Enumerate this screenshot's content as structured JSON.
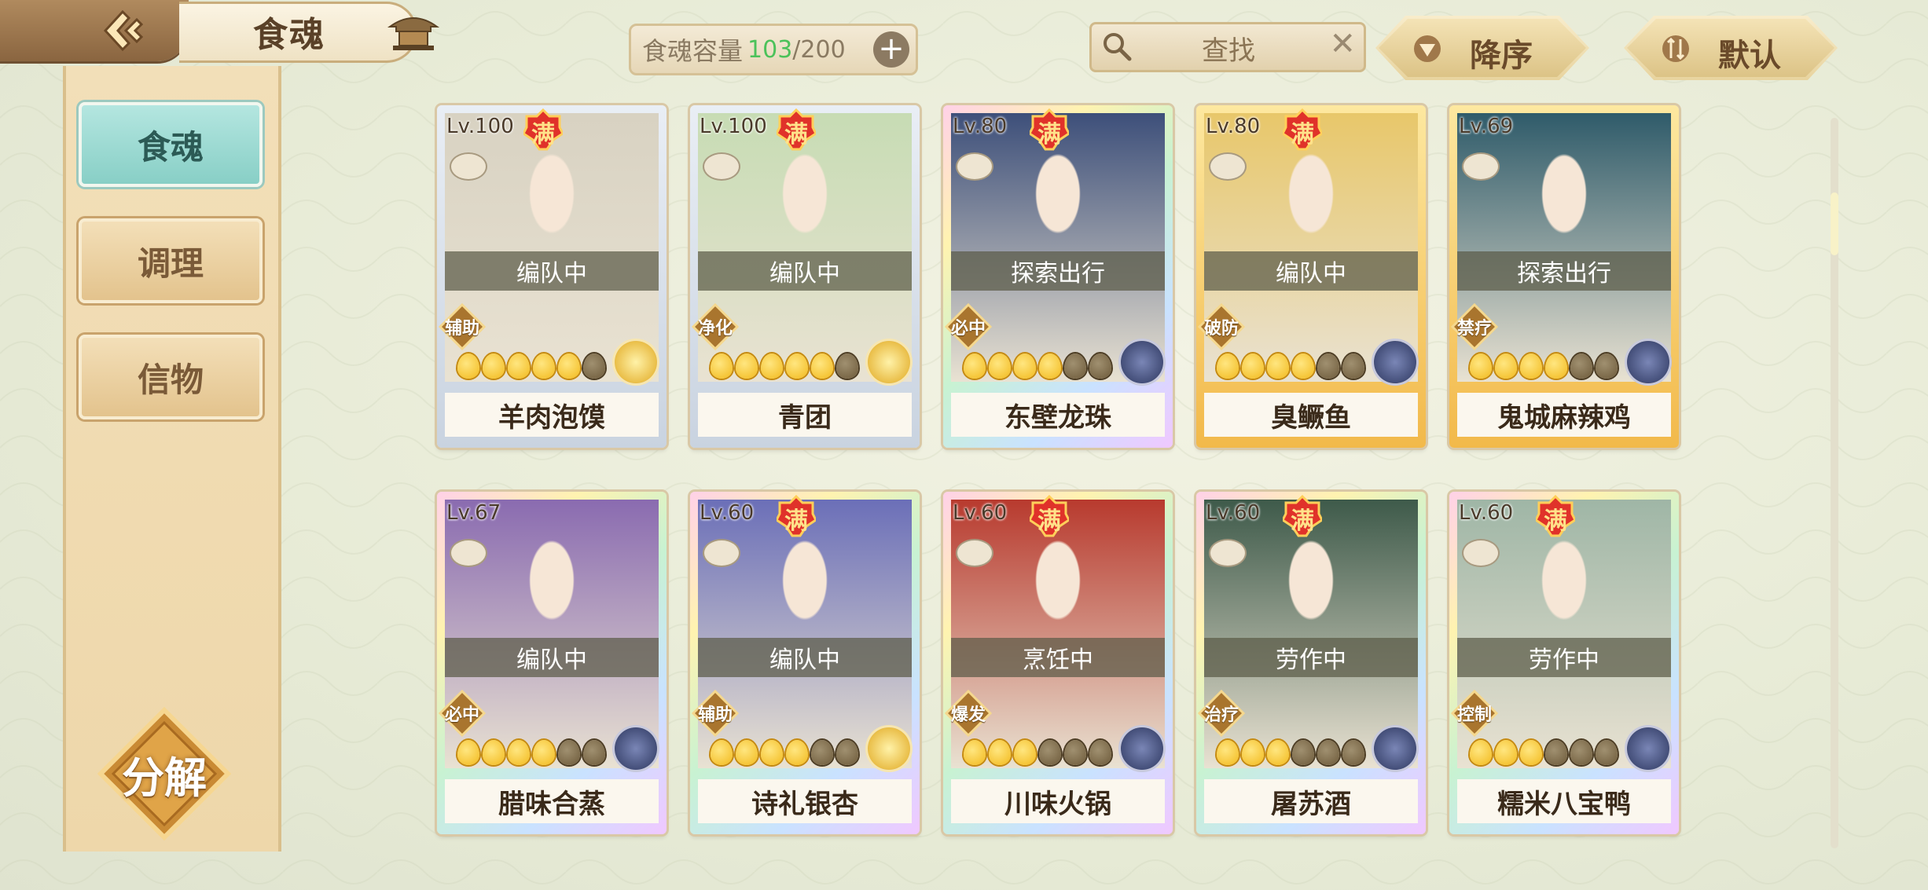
{
  "header": {
    "title": "食魂",
    "back_icon": "back-arrow-icon",
    "home_icon": "pavilion-icon",
    "capacity": {
      "label": "食魂容量",
      "used": "103",
      "total": "200"
    },
    "search": {
      "placeholder": "查找"
    },
    "sort_order_label": "降序",
    "sort_type_label": "默认"
  },
  "sidebar": {
    "tabs": [
      {
        "label": "食魂",
        "active": true
      },
      {
        "label": "调理",
        "active": false
      },
      {
        "label": "信物",
        "active": false
      }
    ],
    "decompose_label": "分解"
  },
  "cards": [
    {
      "name": "羊肉泡馍",
      "level": "Lv.100",
      "full": "满",
      "status": "编队中",
      "role": "辅助",
      "stars": 5,
      "badge": "gold",
      "rarity": "silver",
      "portrait_hue": "#d8d2c2"
    },
    {
      "name": "青团",
      "level": "Lv.100",
      "full": "满",
      "status": "编队中",
      "role": "净化",
      "stars": 5,
      "badge": "gold",
      "rarity": "silver",
      "portrait_hue": "#c7dcb4"
    },
    {
      "name": "东壁龙珠",
      "level": "Lv.80",
      "full": "满",
      "status": "探索出行",
      "role": "必中",
      "stars": 4,
      "badge": "blue",
      "rarity": "rainbow",
      "portrait_hue": "#3d4f7a"
    },
    {
      "name": "臭鳜鱼",
      "level": "Lv.80",
      "full": "满",
      "status": "编队中",
      "role": "破防",
      "stars": 4,
      "badge": "blue",
      "rarity": "gold",
      "portrait_hue": "#e8c76a"
    },
    {
      "name": "鬼城麻辣鸡",
      "level": "Lv.69",
      "full": "",
      "status": "探索出行",
      "role": "禁疗",
      "stars": 4,
      "badge": "blue",
      "rarity": "gold",
      "portrait_hue": "#2f5b6a"
    },
    {
      "name": "腊味合蒸",
      "level": "Lv.67",
      "full": "",
      "status": "编队中",
      "role": "必中",
      "stars": 4,
      "badge": "blue",
      "rarity": "rainbow",
      "portrait_hue": "#8a6bb0"
    },
    {
      "name": "诗礼银杏",
      "level": "Lv.60",
      "full": "满",
      "status": "编队中",
      "role": "辅助",
      "stars": 4,
      "badge": "gold",
      "rarity": "rainbow",
      "portrait_hue": "#6b6fb8"
    },
    {
      "name": "川味火锅",
      "level": "Lv.60",
      "full": "满",
      "status": "烹饪中",
      "role": "爆发",
      "stars": 3,
      "badge": "blue",
      "rarity": "rainbow",
      "portrait_hue": "#b83a2e"
    },
    {
      "name": "屠苏酒",
      "level": "Lv.60",
      "full": "满",
      "status": "劳作中",
      "role": "治疗",
      "stars": 3,
      "badge": "blue",
      "rarity": "rainbow",
      "portrait_hue": "#3e5a4a"
    },
    {
      "name": "糯米八宝鸭",
      "level": "Lv.60",
      "full": "满",
      "status": "劳作中",
      "role": "控制",
      "stars": 3,
      "badge": "blue",
      "rarity": "rainbow",
      "portrait_hue": "#9fb6a6"
    }
  ]
}
